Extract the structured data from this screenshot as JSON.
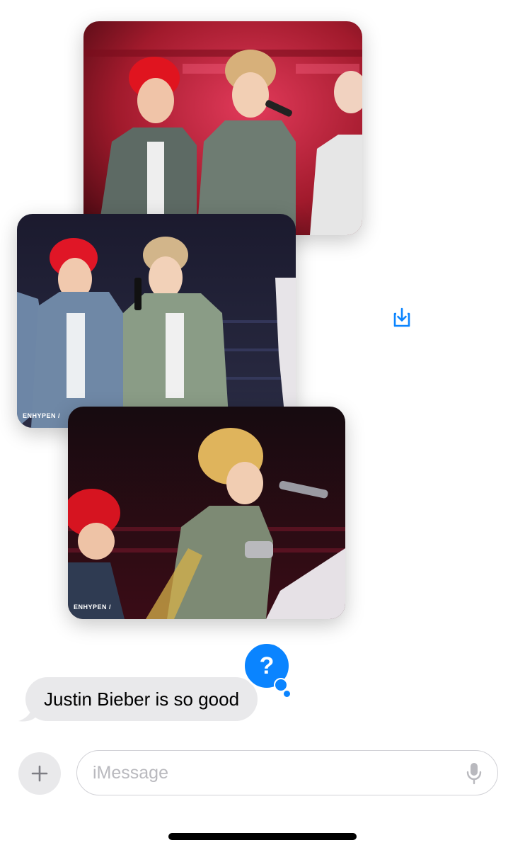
{
  "photos": [
    {
      "watermark": ""
    },
    {
      "watermark": "ENHYPEN /"
    },
    {
      "watermark": "ENHYPEN /"
    }
  ],
  "message": {
    "text": "Justin Bieber is so good",
    "tapback": "?"
  },
  "composer": {
    "placeholder": "iMessage"
  },
  "icons": {
    "save": "save-image-icon",
    "plus": "plus-icon",
    "mic": "microphone-icon"
  },
  "colors": {
    "accent": "#0a84ff",
    "bubble_gray": "#e9e9eb"
  }
}
